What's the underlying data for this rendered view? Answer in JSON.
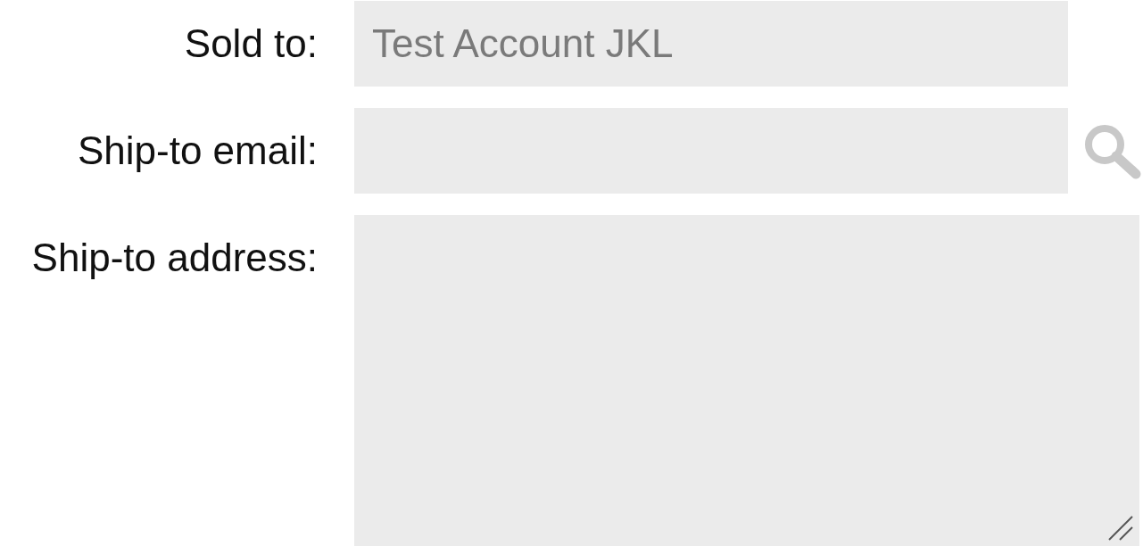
{
  "fields": [
    {
      "kind": "text",
      "label": "Sold to:",
      "value": "Test Account JKL"
    },
    {
      "kind": "lookup",
      "label": "Ship-to email:"
    },
    {
      "kind": "textarea",
      "label": "Ship-to address:"
    }
  ]
}
